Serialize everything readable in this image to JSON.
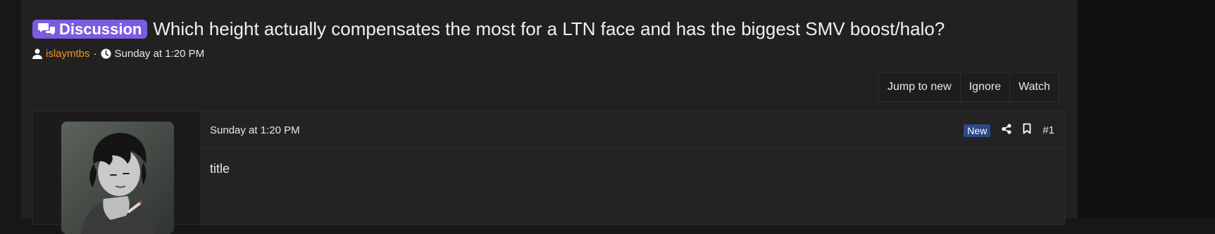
{
  "thread": {
    "prefix": "Discussion",
    "title": "Which height actually compensates the most for a LTN face and has the biggest SMV boost/halo?",
    "author": "islaymtbs",
    "separator": "·",
    "date": "Sunday at 1:20 PM"
  },
  "actions": {
    "jump_to_new": "Jump to new",
    "ignore": "Ignore",
    "watch": "Watch"
  },
  "post": {
    "date": "Sunday at 1:20 PM",
    "new_badge": "New",
    "number": "#1",
    "body": "title",
    "avatar_icon": "user-avatar"
  },
  "colors": {
    "prefix_bg": "#7a5ce2",
    "username": "#f0922c",
    "new_badge_bg": "#2c4a88",
    "page_bg": "#212121"
  },
  "icons": {
    "prefix": "chat-bubbles-icon",
    "author": "user-icon",
    "date": "clock-icon",
    "share": "share-icon",
    "bookmark": "bookmark-icon"
  }
}
